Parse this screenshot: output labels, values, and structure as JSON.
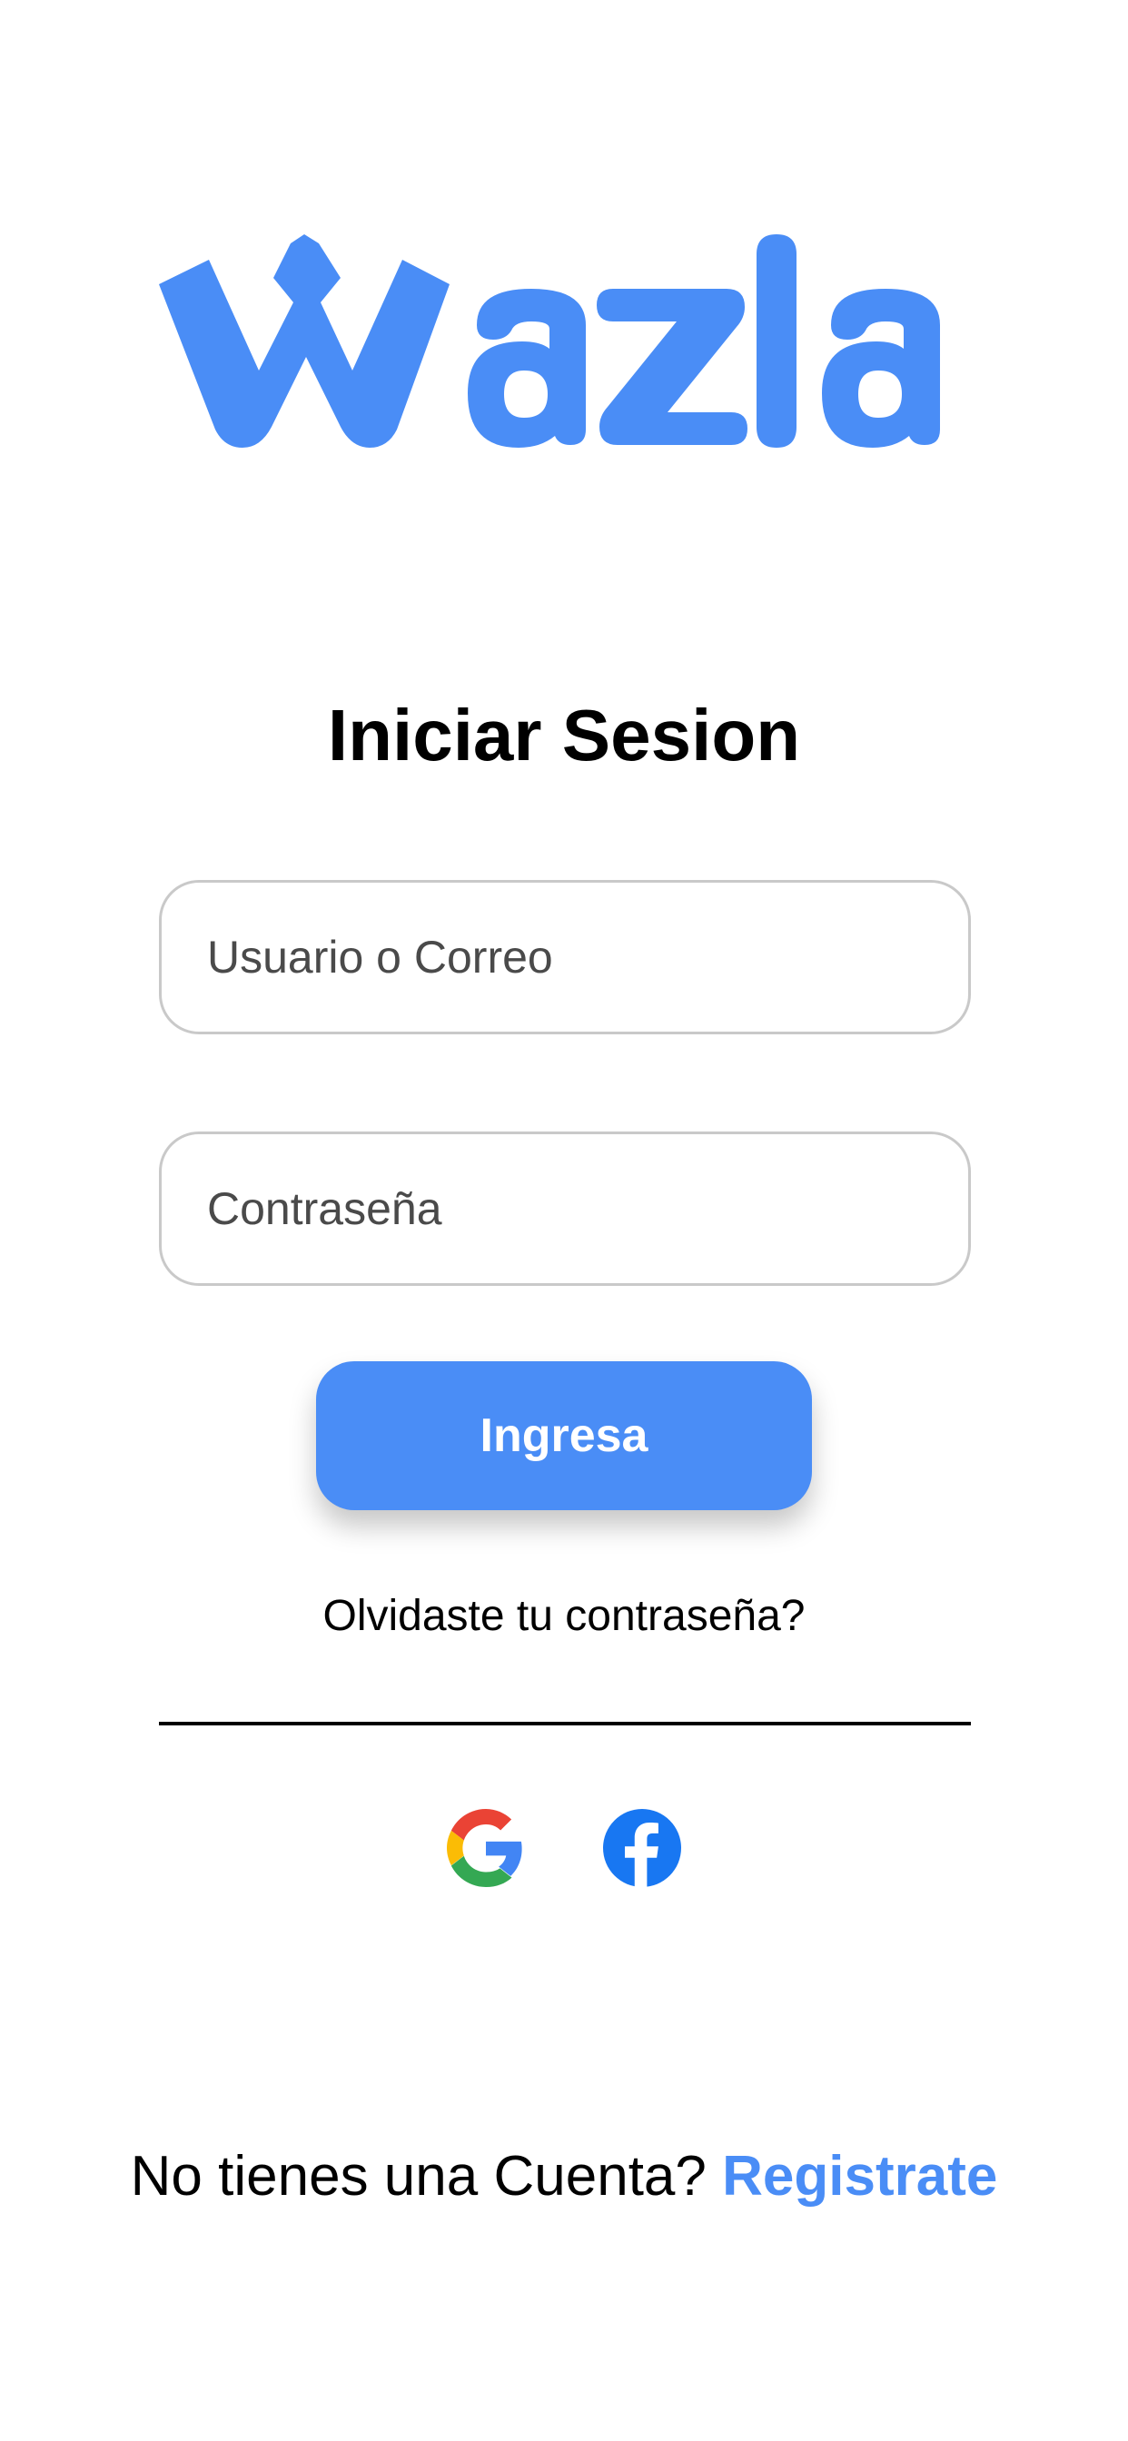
{
  "brand": {
    "logo_text": "Wazla",
    "color": "#4a8df6"
  },
  "login": {
    "title": "Iniciar Sesion",
    "username_placeholder": "Usuario o Correo",
    "password_placeholder": "Contraseña",
    "submit_label": "Ingresa",
    "forgot_label": "Olvidaste tu contraseña?"
  },
  "social": {
    "google_icon": "google-icon",
    "facebook_icon": "facebook-icon"
  },
  "signup": {
    "prompt": "No tienes una Cuenta?",
    "link_label": "Registrate"
  },
  "colors": {
    "accent": "#4a8df6",
    "field_border": "#c9c9c9",
    "text": "#000000"
  }
}
